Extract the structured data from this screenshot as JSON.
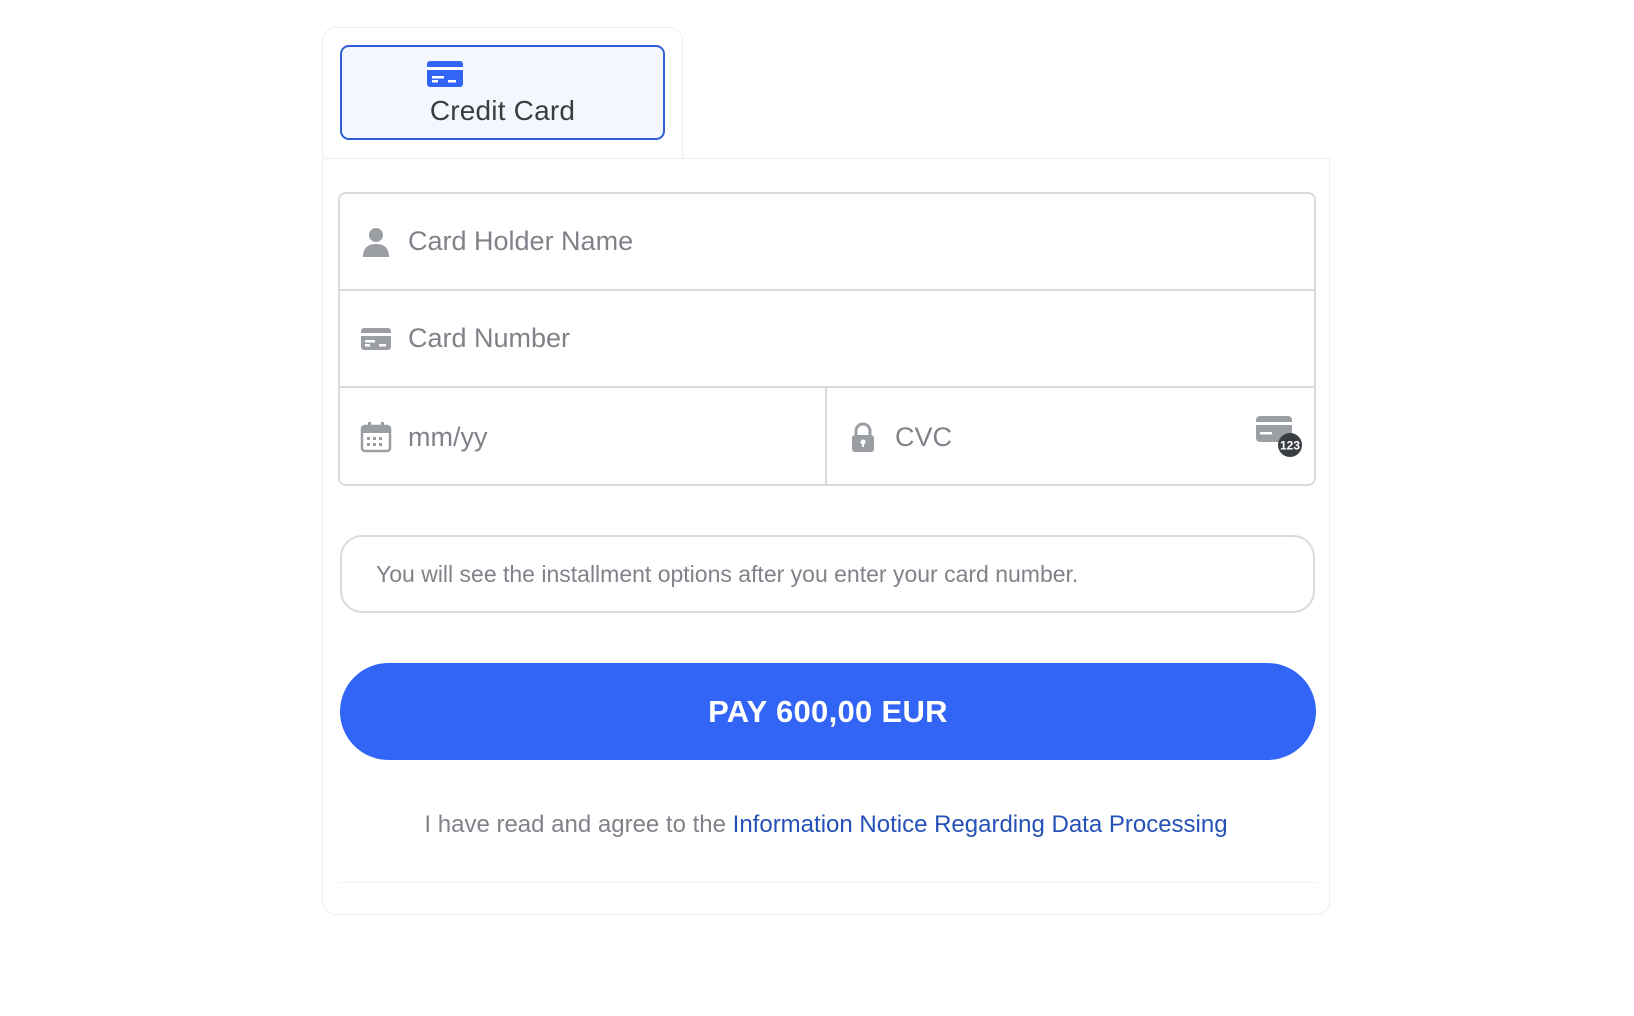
{
  "tabs": [
    {
      "label": "Credit Card",
      "icon": "credit-card-icon",
      "active": true
    }
  ],
  "form": {
    "card_holder": {
      "placeholder": "Card Holder Name",
      "value": "",
      "icon": "user-icon"
    },
    "card_number": {
      "placeholder": "Card Number",
      "value": "",
      "icon": "credit-card-icon"
    },
    "expiry": {
      "placeholder": "mm/yy",
      "value": "",
      "icon": "calendar-icon"
    },
    "cvc": {
      "placeholder": "CVC",
      "value": "",
      "icon": "lock-icon",
      "badge_text": "123"
    }
  },
  "installment_text": "You will see the installment options after you enter your card number.",
  "pay_button": {
    "label": "PAY 600,00 EUR"
  },
  "agreement": {
    "prefix": "I have read and agree to the",
    "link_text": "Information Notice Regarding Data Processing"
  },
  "colors": {
    "accent": "#3264f5",
    "tab_border": "#3060d8",
    "link": "#2552b8",
    "placeholder": "#7f8389",
    "border": "#d8dadd"
  }
}
